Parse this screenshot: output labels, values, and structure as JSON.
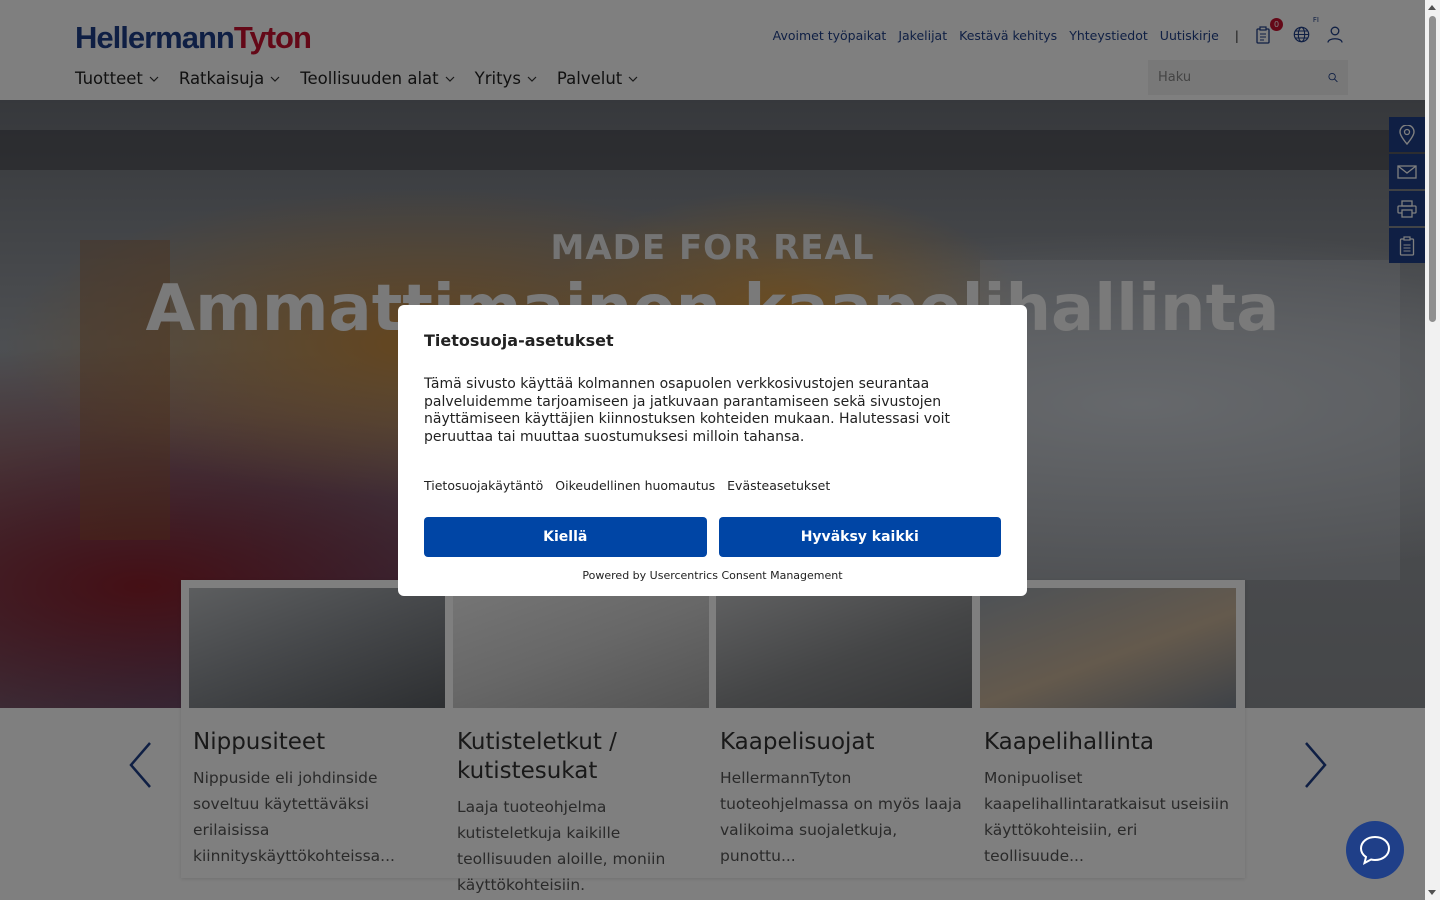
{
  "header": {
    "logo_part1": "Hellermann",
    "logo_part2": "Tyton",
    "util_links": [
      "Avoimet työpaikat",
      "Jakelijat",
      "Kestävä kehitys",
      "Yhteystiedot",
      "Uutiskirje"
    ],
    "separator": "|",
    "cart_count": "0",
    "lang_label": "FI",
    "nav": [
      "Tuotteet",
      "Ratkaisuja",
      "Teollisuuden alat",
      "Yritys",
      "Palvelut"
    ],
    "search_placeholder": "Haku"
  },
  "hero": {
    "subtitle": "MADE FOR REAL",
    "title": "Ammattimainen kaapelihallinta"
  },
  "cards": [
    {
      "title": "Nippusiteet",
      "text": "Nippuside eli johdinside soveltuu käytettäväksi erilaisissa kiinnityskäyttökohteissa..."
    },
    {
      "title": "Kutisteletkut / kutistesukat",
      "text": "Laaja tuoteohjelma kutisteletkuja kaikille teollisuuden aloille, moniin käyttökohteisiin."
    },
    {
      "title": "Kaapelisuojat",
      "text": "HellermannTyton tuoteohjelmassa on myös laaja valikoima suojaletkuja, punottu..."
    },
    {
      "title": "Kaapelihallinta",
      "text": "Monipuoliset kaapelihallintaratkaisut useisiin käyttökohteisiin, eri teollisuude..."
    }
  ],
  "consent": {
    "title": "Tietosuoja-asetukset",
    "body": "Tämä sivusto käyttää kolmannen osapuolen verkkosivustojen seurantaa palveluidemme tarjoamiseen ja jatkuvaan parantamiseen sekä sivustojen näyttämiseen käyttäjien kiinnostuksen kohteiden mukaan. Halutessasi voit peruuttaa tai muuttaa suostumuksesi milloin tahansa.",
    "link_privacy": "Tietosuojakäytäntö",
    "link_legal": "Oikeudellinen huomautus",
    "link_cookies": "Evästeasetukset",
    "deny_label": "Kiellä",
    "accept_label": "Hyväksy kaikki",
    "powered": "Powered by Usercentrics Consent Management"
  },
  "colors": {
    "brand_blue": "#1f3f88",
    "brand_red": "#c8102e",
    "button_blue": "#0045a5"
  }
}
